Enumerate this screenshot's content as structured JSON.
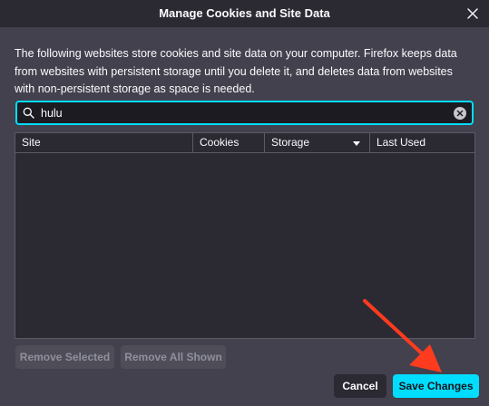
{
  "dialog": {
    "title": "Manage Cookies and Site Data",
    "description": "The following websites store cookies and site data on your computer. Firefox keeps data from websites with persistent storage until you delete it, and deletes data from websites with non-persistent storage as space is needed."
  },
  "search": {
    "value": "hulu",
    "icon": "search-icon",
    "clear_icon": "clear-icon"
  },
  "table": {
    "columns": [
      {
        "label": "Site"
      },
      {
        "label": "Cookies"
      },
      {
        "label": "Storage",
        "sorted": "descending"
      },
      {
        "label": "Last Used"
      }
    ],
    "rows": []
  },
  "buttons": {
    "remove_selected": "Remove Selected",
    "remove_all_shown": "Remove All Shown",
    "cancel": "Cancel",
    "save_changes": "Save Changes"
  },
  "colors": {
    "accent": "#00ddff",
    "dialog_bg": "#42414d",
    "annotation_arrow": "#ff3b1f"
  }
}
